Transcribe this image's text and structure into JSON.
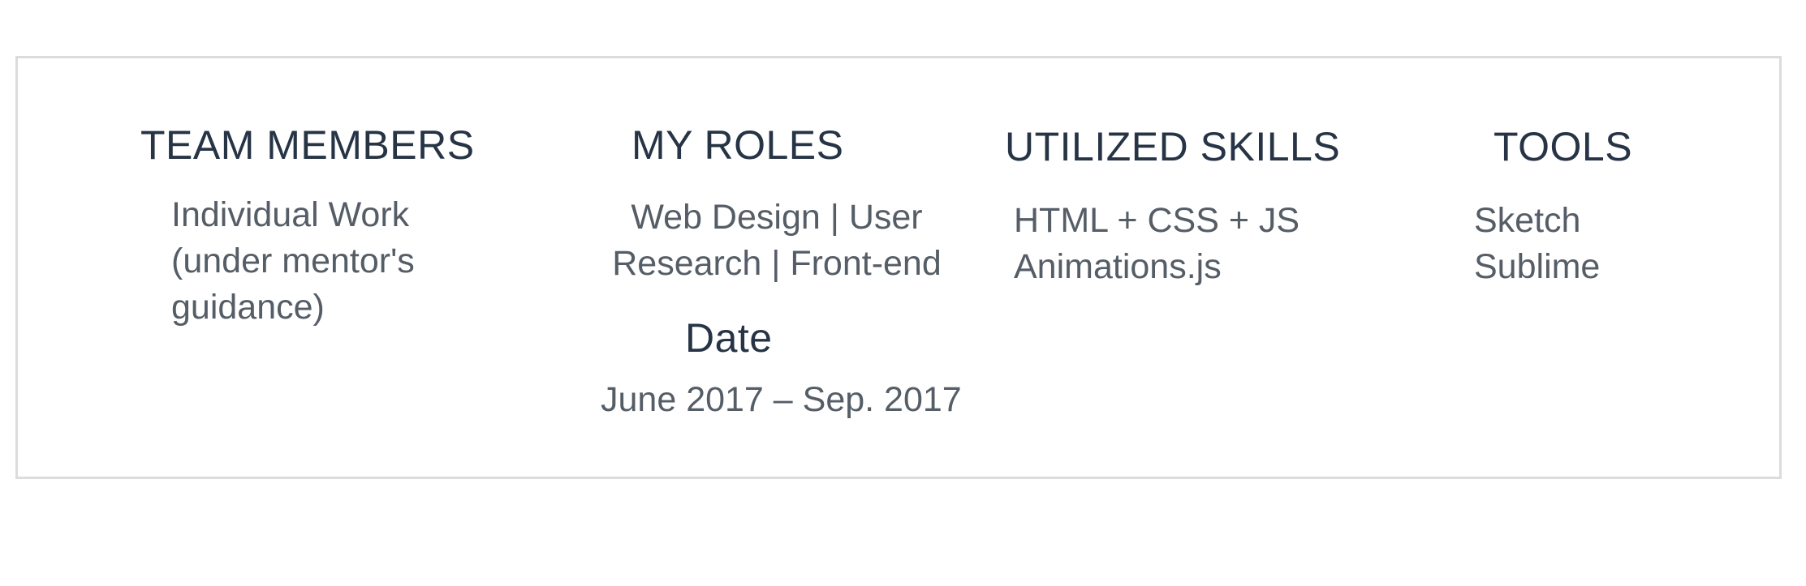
{
  "sections": {
    "team": {
      "heading": "TEAM MEMBERS",
      "lines": [
        "Individual Work",
        "(under mentor's",
        "guidance)"
      ]
    },
    "roles": {
      "heading": "MY ROLES",
      "lines": [
        "Web Design | User",
        "Research | Front-end"
      ]
    },
    "date": {
      "heading": "Date",
      "value": "June 2017 – Sep. 2017"
    },
    "skills": {
      "heading": "UTILIZED SKILLS",
      "lines": [
        "HTML + CSS + JS",
        "Animations.js"
      ]
    },
    "tools": {
      "heading": "TOOLS",
      "lines": [
        "Sketch",
        "Sublime"
      ]
    }
  },
  "colors": {
    "heading": "#263445",
    "body": "#555d66",
    "border": "#dcdcdc"
  }
}
